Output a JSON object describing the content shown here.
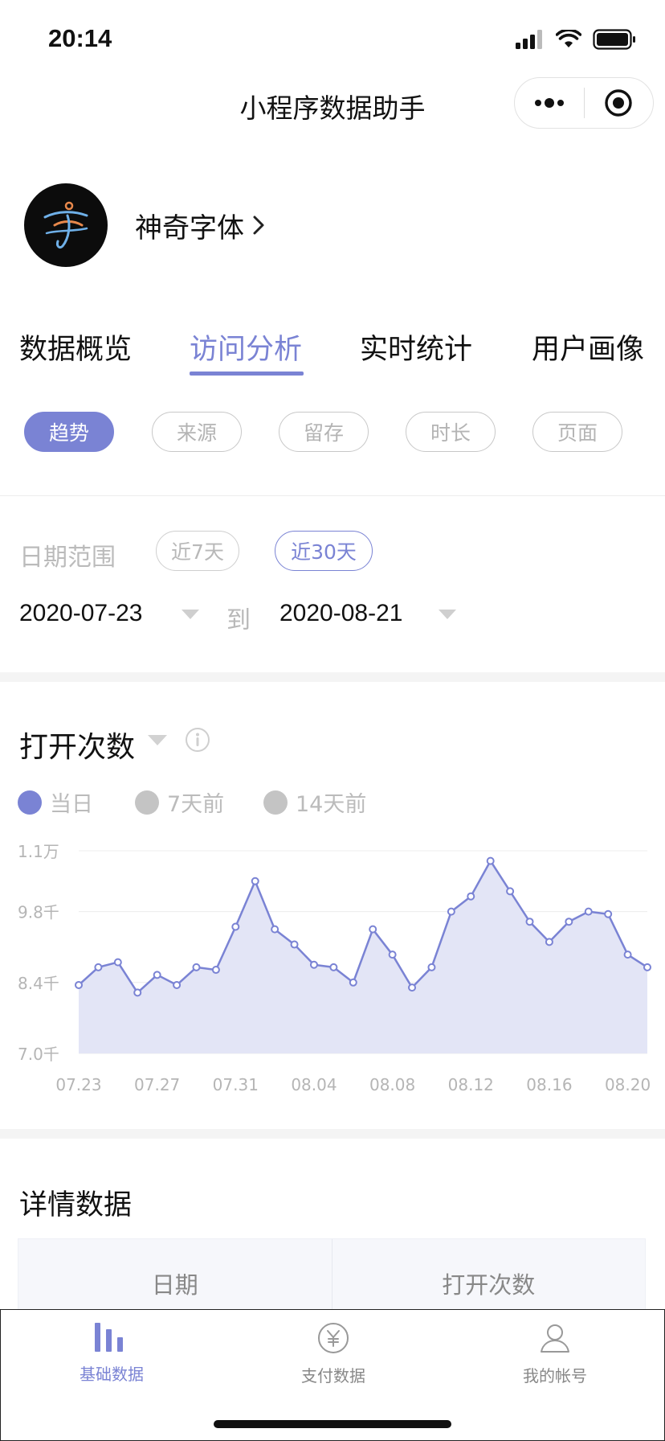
{
  "status_bar": {
    "time": "20:14"
  },
  "nav": {
    "title": "小程序数据助手"
  },
  "app": {
    "name": "神奇字体"
  },
  "main_tabs": [
    {
      "label": "数据概览",
      "active": false
    },
    {
      "label": "访问分析",
      "active": true
    },
    {
      "label": "实时统计",
      "active": false
    },
    {
      "label": "用户画像",
      "active": false
    }
  ],
  "sub_tabs": [
    {
      "label": "趋势",
      "active": true
    },
    {
      "label": "来源",
      "active": false
    },
    {
      "label": "留存",
      "active": false
    },
    {
      "label": "时长",
      "active": false
    },
    {
      "label": "页面",
      "active": false
    }
  ],
  "date_range": {
    "label": "日期范围",
    "options": [
      {
        "label": "近7天",
        "active": false
      },
      {
        "label": "近30天",
        "active": true
      }
    ],
    "start": "2020-07-23",
    "to_label": "到",
    "end": "2020-08-21"
  },
  "metric": {
    "title": "打开次数"
  },
  "legend": [
    {
      "label": "当日",
      "color": "#7a83d4"
    },
    {
      "label": "7天前",
      "color": "#c4c4c4"
    },
    {
      "label": "14天前",
      "color": "#c4c4c4"
    }
  ],
  "chart_data": {
    "type": "area",
    "y_tick_labels": [
      "1.1万",
      "9.8千",
      "8.4千",
      "7.0千"
    ],
    "y_ticks": [
      11000,
      9800,
      8400,
      7000
    ],
    "ylim": [
      7000,
      11000
    ],
    "x_tick_labels": [
      "07.23",
      "07.27",
      "07.31",
      "08.04",
      "08.08",
      "08.12",
      "08.16",
      "08.20"
    ],
    "x": [
      "07.23",
      "07.24",
      "07.25",
      "07.26",
      "07.27",
      "07.28",
      "07.29",
      "07.30",
      "07.31",
      "08.01",
      "08.02",
      "08.03",
      "08.04",
      "08.05",
      "08.06",
      "08.07",
      "08.08",
      "08.09",
      "08.10",
      "08.11",
      "08.12",
      "08.13",
      "08.14",
      "08.15",
      "08.16",
      "08.17",
      "08.18",
      "08.19",
      "08.20",
      "08.21"
    ],
    "series": [
      {
        "name": "当日",
        "color": "#7a83d4",
        "values": [
          8350,
          8700,
          8800,
          8200,
          8550,
          8350,
          8700,
          8650,
          9500,
          10400,
          9450,
          9150,
          8750,
          8700,
          8400,
          9450,
          8950,
          8300,
          8700,
          9800,
          10100,
          10800,
          10200,
          9600,
          9200,
          9600,
          9800,
          9750,
          8950,
          8700
        ]
      }
    ],
    "grid": true
  },
  "details": {
    "title": "详情数据",
    "columns": [
      "日期",
      "打开次数"
    ]
  },
  "tab_bar": [
    {
      "label": "基础数据",
      "icon": "bar-chart-icon",
      "active": true
    },
    {
      "label": "支付数据",
      "icon": "yuan-coin-icon",
      "active": false
    },
    {
      "label": "我的帐号",
      "icon": "user-icon",
      "active": false
    }
  ]
}
